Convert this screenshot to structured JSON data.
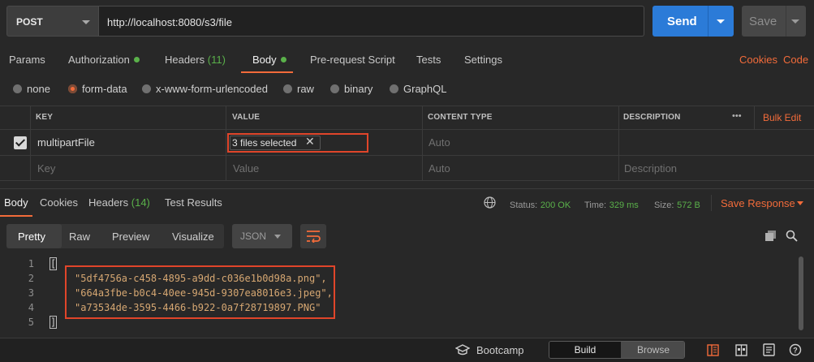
{
  "request": {
    "method": "POST",
    "url": "http://localhost:8080/s3/file",
    "send_label": "Send",
    "save_label": "Save"
  },
  "request_tabs": [
    {
      "label": "Params"
    },
    {
      "label": "Authorization"
    },
    {
      "label": "Headers",
      "count": "(11)"
    },
    {
      "label": "Body"
    },
    {
      "label": "Pre-request Script"
    },
    {
      "label": "Tests"
    },
    {
      "label": "Settings"
    }
  ],
  "links": {
    "cookies": "Cookies",
    "code": "Code"
  },
  "body_types": [
    "none",
    "form-data",
    "x-www-form-urlencoded",
    "raw",
    "binary",
    "GraphQL"
  ],
  "selected_body_type": "form-data",
  "table": {
    "headers": {
      "key": "KEY",
      "value": "VALUE",
      "content_type": "CONTENT TYPE",
      "description": "DESCRIPTION"
    },
    "more": "•••",
    "bulk_edit": "Bulk Edit",
    "row": {
      "key": "multipartFile",
      "value": "3 files selected",
      "content_type": "Auto"
    },
    "placeholders": {
      "key": "Key",
      "value": "Value",
      "content_type": "Auto",
      "description": "Description"
    }
  },
  "response_tabs": [
    {
      "label": "Body"
    },
    {
      "label": "Cookies"
    },
    {
      "label": "Headers",
      "count": "(14)"
    },
    {
      "label": "Test Results"
    }
  ],
  "status": {
    "status_label": "Status:",
    "status_value": "200 OK",
    "time_label": "Time:",
    "time_value": "329 ms",
    "size_label": "Size:",
    "size_value": "572 B",
    "save_response": "Save Response"
  },
  "view_modes": [
    "Pretty",
    "Raw",
    "Preview",
    "Visualize"
  ],
  "format": "JSON",
  "code_lines": [
    {
      "num": "1",
      "text": "["
    },
    {
      "num": "2",
      "text": "\"5df4756a-c458-4895-a9dd-c036e1b0d98a.png\","
    },
    {
      "num": "3",
      "text": "\"664a3fbe-b0c4-40ee-945d-9307ea8016e3.jpeg\","
    },
    {
      "num": "4",
      "text": "\"a73534de-3595-4466-b922-0a7f28719897.PNG\""
    },
    {
      "num": "5",
      "text": "]"
    }
  ],
  "bottom": {
    "bootcamp": "Bootcamp",
    "build": "Build",
    "browse": "Browse"
  },
  "colors": {
    "accent_orange": "#f26b3a",
    "send_blue": "#2b7bd8",
    "success_green": "#5ab14a",
    "highlight_red": "#e0452a"
  }
}
